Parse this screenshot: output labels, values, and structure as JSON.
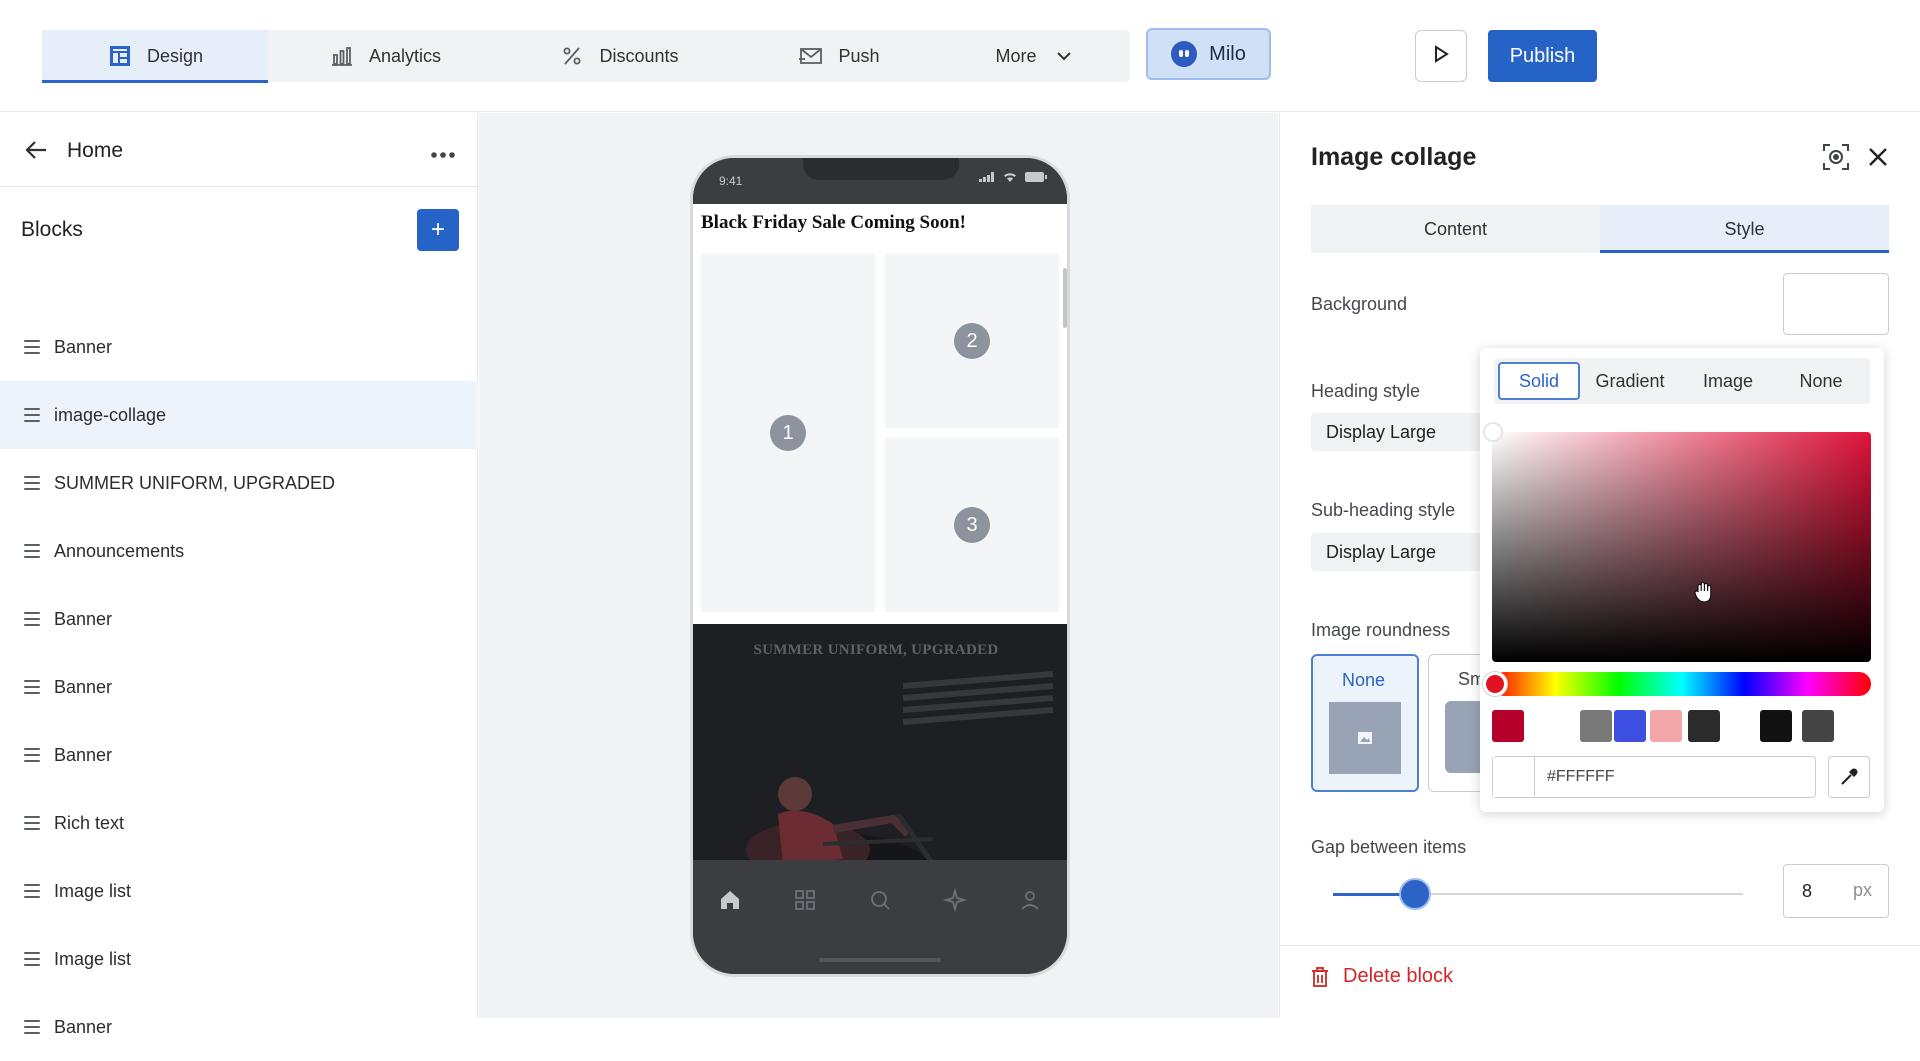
{
  "topbar": {
    "tabs": [
      {
        "label": "Design",
        "icon": "layout-icon"
      },
      {
        "label": "Analytics",
        "icon": "bar-chart-icon"
      },
      {
        "label": "Discounts",
        "icon": "percent-icon"
      },
      {
        "label": "Push",
        "icon": "mail-send-icon"
      },
      {
        "label": "More",
        "icon": "chevron-down-icon"
      }
    ],
    "active_tab": "Design",
    "milo_label": "Milo",
    "publish_label": "Publish"
  },
  "left": {
    "home_title": "Home",
    "blocks_title": "Blocks",
    "add_label": "+",
    "blocks": [
      "Banner",
      "image-collage",
      "SUMMER UNIFORM, UPGRADED",
      "Announcements",
      "Banner",
      "Banner",
      "Banner",
      "Rich text",
      "Image list",
      "Image list",
      "Banner"
    ],
    "selected_block": "image-collage"
  },
  "preview": {
    "status_time": "9:41",
    "collage_title": "Black Friday Sale Coming Soon!",
    "tiles": [
      "1",
      "2",
      "3"
    ],
    "banner_title": "SUMMER UNIFORM, UPGRADED"
  },
  "right": {
    "title": "Image collage",
    "tabs": [
      "Content",
      "Style"
    ],
    "active_tab": "Style",
    "background_label": "Background",
    "heading_style_label": "Heading style",
    "heading_style_value": "Display Large",
    "subheading_style_label": "Sub-heading style",
    "subheading_style_value": "Display Large",
    "image_roundness_label": "Image roundness",
    "roundness_options": [
      "None",
      "Sm"
    ],
    "roundness_selected": "None",
    "gap_label": "Gap between items",
    "gap_value": "8",
    "gap_unit": "px",
    "gap_slider_fraction": 0.2,
    "delete_label": "Delete block"
  },
  "picker": {
    "modes": [
      "Solid",
      "Gradient",
      "Image",
      "None"
    ],
    "active_mode": "Solid",
    "hex_value": "#FFFFFF",
    "swatches": [
      "#b5002c",
      "#ffffff",
      "#787878",
      "#3d4fe0",
      "#f2a6a8",
      "#2b2b2b",
      "#ffffff",
      "#121212",
      "#444444"
    ]
  },
  "colors": {
    "accent": "#2563c6",
    "danger": "#d02727"
  }
}
